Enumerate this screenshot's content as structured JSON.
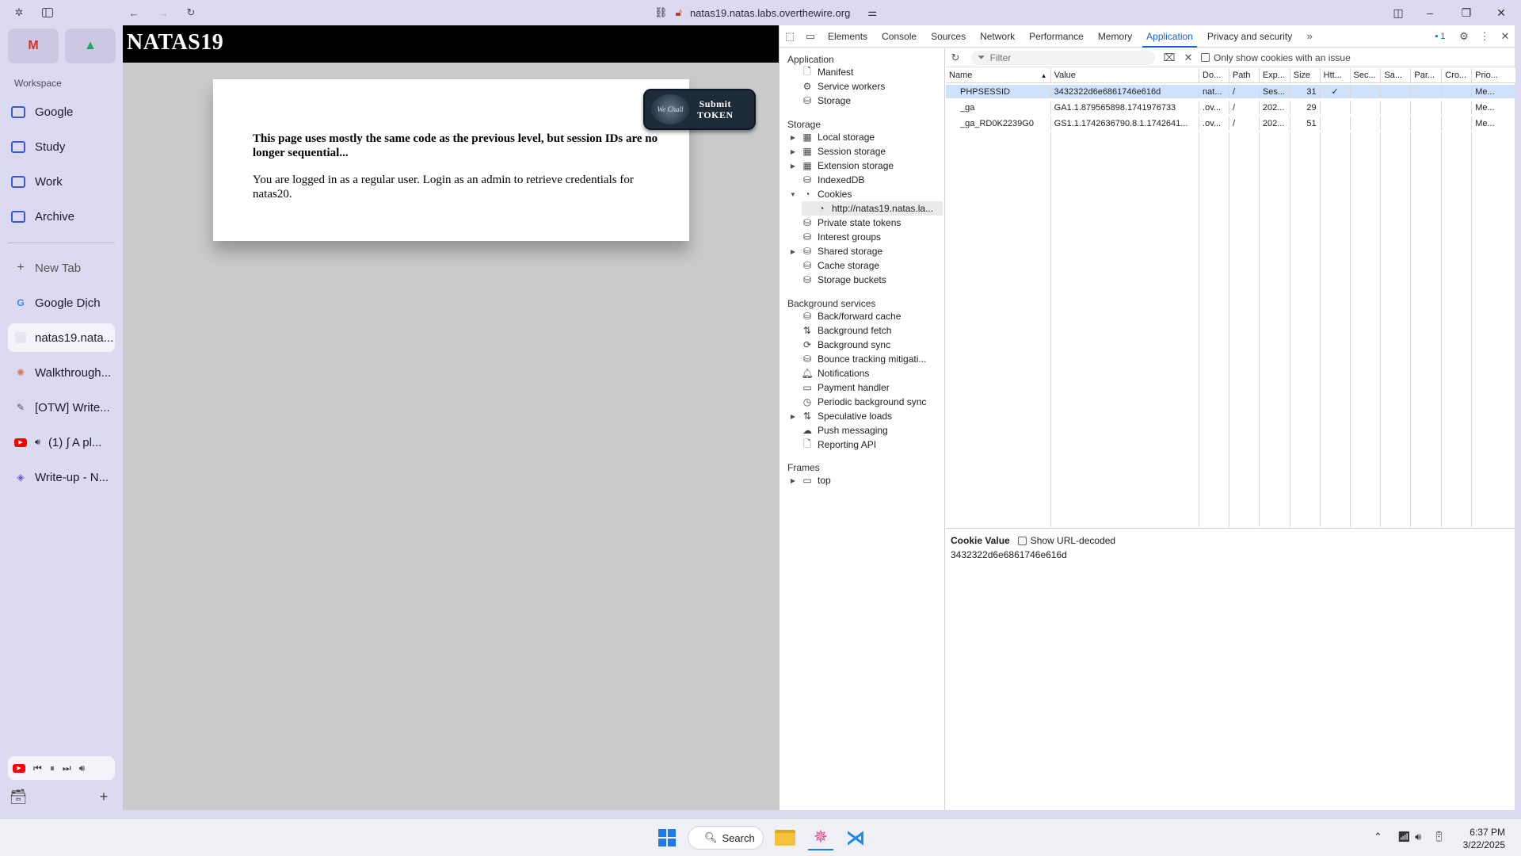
{
  "browser": {
    "url": "natas19.natas.labs.overthewire.org"
  },
  "sidebar": {
    "workspace_label": "Workspace",
    "folders": [
      "Google",
      "Study",
      "Work",
      "Archive"
    ],
    "new_tab_label": "New Tab",
    "tabs": [
      {
        "label": "Google Dịch",
        "icon": "translate-icon"
      },
      {
        "label": "natas19.nata...",
        "icon": "page-icon"
      },
      {
        "label": "Walkthrough...",
        "icon": "claude-icon"
      },
      {
        "label": "[OTW] Write...",
        "icon": "write-icon"
      },
      {
        "label": "(1) ∫ A pl...",
        "icon": "youtube-icon"
      },
      {
        "label": "Write-up - N...",
        "icon": "doc-icon"
      }
    ]
  },
  "page": {
    "site_title": "NATAS19",
    "paragraph1": "This page uses mostly the same code as the previous level, but session IDs are no longer sequential...",
    "paragraph2": "You are logged in as a regular user. Login as an admin to retrieve credentials for natas20.",
    "submit_token_line1": "Submit",
    "submit_token_line2": "Token",
    "globe_text": "We Chall"
  },
  "devtools": {
    "tabs": [
      "Elements",
      "Console",
      "Sources",
      "Network",
      "Performance",
      "Memory",
      "Application",
      "Privacy and security"
    ],
    "active_tab": "Application",
    "issues_count": "1",
    "nav": {
      "application_header": "Application",
      "application_items": [
        "Manifest",
        "Service workers",
        "Storage"
      ],
      "storage_header": "Storage",
      "storage_items": [
        "Local storage",
        "Session storage",
        "Extension storage",
        "IndexedDB",
        "Cookies"
      ],
      "cookie_origin": "http://natas19.natas.la...",
      "storage_items_2": [
        "Private state tokens",
        "Interest groups",
        "Shared storage",
        "Cache storage",
        "Storage buckets"
      ],
      "background_header": "Background services",
      "background_items": [
        "Back/forward cache",
        "Background fetch",
        "Background sync",
        "Bounce tracking mitigati...",
        "Notifications",
        "Payment handler",
        "Periodic background sync",
        "Speculative loads",
        "Push messaging",
        "Reporting API"
      ],
      "frames_header": "Frames",
      "frames_items": [
        "top"
      ]
    },
    "filter_placeholder": "Filter",
    "only_issues_label": "Only show cookies with an issue",
    "columns": [
      "Name",
      "Value",
      "Do...",
      "Path",
      "Exp...",
      "Size",
      "Htt...",
      "Sec...",
      "Sa...",
      "Par...",
      "Cro...",
      "Prio..."
    ],
    "rows": [
      [
        "PHPSESSID",
        "3432322d6e6861746e616d",
        "nat...",
        "/",
        "Ses...",
        "31",
        "✓",
        "",
        "",
        "",
        "",
        "Me..."
      ],
      [
        "_ga",
        "GA1.1.879565898.1741976733",
        ".ov...",
        "/",
        "202...",
        "29",
        "",
        "",
        "",
        "",
        "",
        "Me..."
      ],
      [
        "_ga_RD0K2239G0",
        "GS1.1.1742636790.8.1.1742641...",
        ".ov...",
        "/",
        "202...",
        "51",
        "",
        "",
        "",
        "",
        "",
        "Me..."
      ]
    ],
    "cookie_value_label": "Cookie Value",
    "show_url_decoded_label": "Show URL-decoded",
    "cookie_value": "3432322d6e6861746e616d"
  },
  "taskbar": {
    "search_label": "Search",
    "time": "6:37 PM",
    "date": "3/22/2025"
  }
}
